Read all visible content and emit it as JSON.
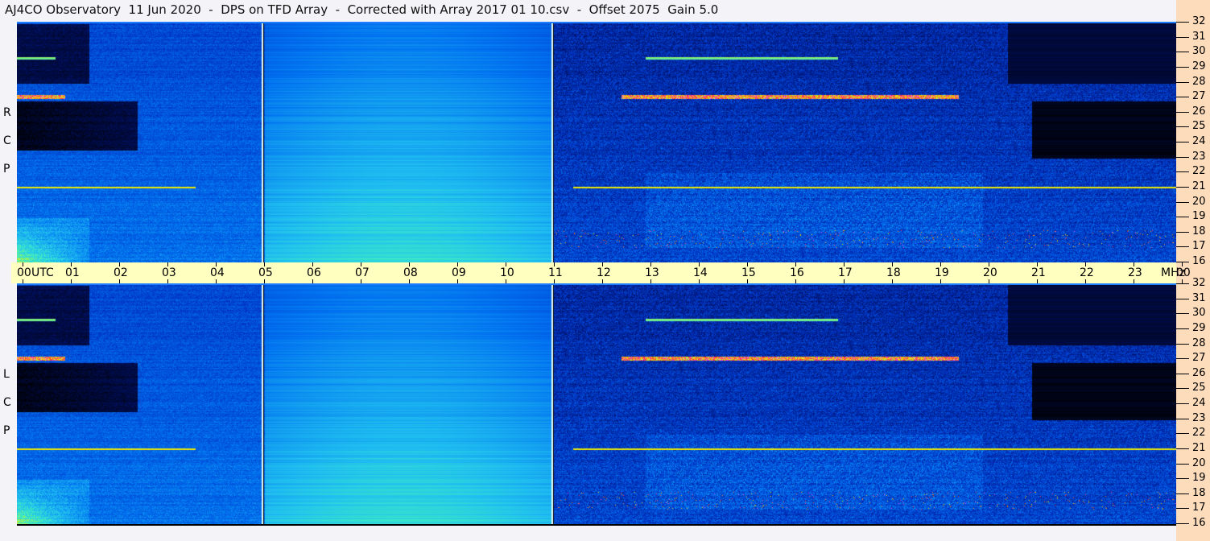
{
  "title": "AJ4CO Observatory  11 Jun 2020  -  DPS on TFD Array  -  Corrected with Array 2017 01 10.csv  -  Offset 2075  Gain 5.0",
  "chart_data": {
    "type": "heatmap",
    "title": "AJ4CO Observatory  11 Jun 2020  -  DPS on TFD Array  -  Corrected with Array 2017 01 10.csv  -  Offset 2075  Gain 5.0",
    "xlabel": "UTC",
    "ylabel": "MHz",
    "x_range": [
      0,
      24
    ],
    "y_range": [
      16,
      32
    ],
    "x_ticks": [
      "00",
      "01",
      "02",
      "03",
      "04",
      "05",
      "06",
      "07",
      "08",
      "09",
      "10",
      "11",
      "12",
      "13",
      "14",
      "15",
      "16",
      "17",
      "18",
      "19",
      "20",
      "21",
      "22",
      "23",
      "00"
    ],
    "x_unit_label": "UTC",
    "y_unit_label": "MHz",
    "y_ticks": [
      "32",
      "31",
      "30",
      "29",
      "28",
      "27",
      "26",
      "25",
      "24",
      "23",
      "22",
      "21",
      "20",
      "19",
      "18",
      "17",
      "16"
    ],
    "panels": [
      {
        "name": "RCP",
        "letters": [
          "R",
          "C",
          "P"
        ]
      },
      {
        "name": "LCP",
        "letters": [
          "L",
          "C",
          "P"
        ]
      }
    ],
    "vertical_markers_utc": [
      5.1,
      11.1
    ],
    "colors": {
      "low": "#000000",
      "mid": "#0070f0",
      "high": "#f0f000",
      "peak": "#ff40ff",
      "axis_band": "#ffffc0",
      "freq_axis_band": "#fddcbc"
    }
  }
}
